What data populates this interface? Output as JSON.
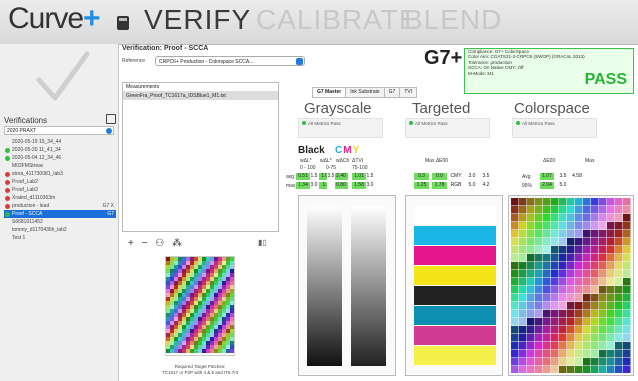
{
  "app": {
    "logo": "Curve",
    "logo_plus": "+"
  },
  "nav": [
    "VERIFY",
    "CALIBRATE",
    "BLEND"
  ],
  "sidebar": {
    "title": "Verifications",
    "search": "2020 PRAXT",
    "items": [
      {
        "label": "2020-05-19 15_34_44",
        "dot": null
      },
      {
        "label": "2020-05-20 11_41_34",
        "dot": "#2fbf3a"
      },
      {
        "label": "2020-05-04 12_34_46",
        "dot": "#2fbf3a"
      },
      {
        "label": "M02FMStreav",
        "dot": null
      },
      {
        "label": "stora_411730081_lab3",
        "dot": "#d93a3a"
      },
      {
        "label": "Proof_Lab2",
        "dot": "#d93a3a"
      },
      {
        "label": "Proof_Lab3",
        "dot": "#d93a3a"
      },
      {
        "label": "Xrated_d1110363m",
        "dot": "#d93a3a"
      },
      {
        "label": "production - lead",
        "dot": "#d93a3a",
        "tag": "G7 X"
      },
      {
        "label": "Proof - SCCA",
        "dot": "#2fbf3a",
        "tag": "G7",
        "selected": true
      },
      {
        "label": "S6681011452",
        "dot": null
      },
      {
        "label": "tommy_d1170436h_lab2",
        "dot": null
      },
      {
        "label": "Test 1",
        "dot": null
      }
    ]
  },
  "verification": {
    "title": "Verification: Proof - SCCA",
    "reference_label": "Reference",
    "reference_value": "CRPC6+ Production - Colorspace SCCA..."
  },
  "measurements": {
    "header": "Measurements",
    "row": "GreenFra_Proof_TC1617a_IDSBlue1_M1.txt"
  },
  "toolbar": {
    "add": "+",
    "remove": "−",
    "person": "⚇",
    "more": "⁂"
  },
  "target_caption": {
    "line1": "Required Target Patches:",
    "line2": "TC1617 or P2P with 4 & 5 and IT8.7/4"
  },
  "g7_logo": "G7+",
  "compliance": {
    "lines": [
      "Compliance: G7+ ColorSpace",
      "Color Aim: CGATS21-2-CRPC6 (SWOP) (GRACoL 2013)",
      "Tolerance: production",
      "SCCA: On    Native CMY: Off",
      "M-Mode: M1"
    ],
    "result": "PASS"
  },
  "tabs": [
    "G7 Master",
    "Ink Substrate",
    "G7",
    "TVI"
  ],
  "sections": [
    {
      "title": "Grayscale",
      "sub": "All Metrics Pass"
    },
    {
      "title": "Targeted",
      "sub": "All Metrics Pass"
    },
    {
      "title": "Colorspace",
      "sub": "All Metrics Pass"
    }
  ],
  "metrics": {
    "black_label": "Black",
    "cmy_letters": [
      "C",
      "M",
      "Y"
    ],
    "black_cols": [
      "wΔL*",
      "wΔL*",
      "wΔCh",
      "ΔTVI"
    ],
    "black_ranges": [
      "0 - 100",
      "0-75",
      "75-100"
    ],
    "rows": [
      "avg",
      "max"
    ],
    "black_vals": [
      [
        "0.51",
        "1.00",
        "2.40",
        "1.01"
      ],
      [
        "1.34",
        "1.8",
        "0.80",
        "1.58"
      ]
    ],
    "black_tol": [
      [
        "1.5",
        "3.5",
        "1.5"
      ],
      [
        "3.0",
        "",
        "3.0"
      ]
    ],
    "targeted_title": "Max ΔE00",
    "targeted_vals": [
      [
        "0.3",
        "0.0",
        "CMY",
        "3.0",
        "3.5"
      ],
      [
        "1.25",
        "1.78",
        "RGB",
        "5.0",
        "4.2"
      ]
    ],
    "colorspace_cols": [
      "ΔE00",
      "Max"
    ],
    "colorspace_rows": [
      "Avg",
      "95%"
    ],
    "colorspace_vals": [
      [
        "1.07",
        "3.5",
        "4.58"
      ],
      [
        "2.04",
        "5.0",
        ""
      ]
    ]
  },
  "colors": {
    "accent": "#1f8ee0",
    "pass": "#25b436",
    "green_cell": "#6fdc5f"
  }
}
